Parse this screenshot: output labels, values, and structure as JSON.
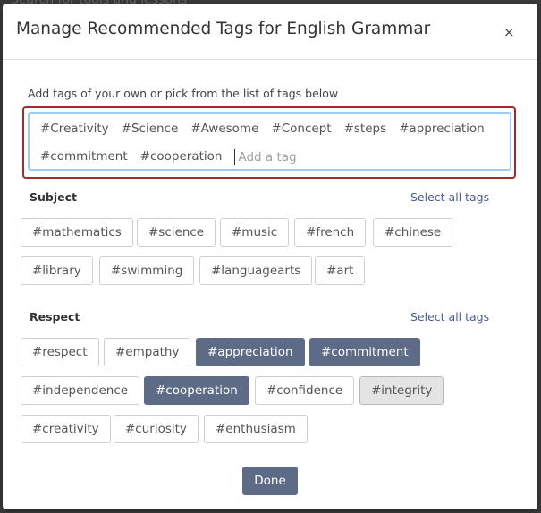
{
  "backdrop": {
    "text": "Search for tools and lessons"
  },
  "modal": {
    "title": "Manage Recommended Tags for English Grammar",
    "close_label": "×",
    "instruction": "Add tags of your own or pick from the list of tags below",
    "selected_tags": {
      "row1": [
        "#Creativity",
        "#Science",
        "#Awesome",
        "#Concept",
        "#steps",
        "#appreciation"
      ],
      "row2": [
        "#commitment",
        "#cooperation"
      ]
    },
    "input_placeholder": "Add a tag",
    "select_all_label": "Select all tags",
    "subject": {
      "title": "Subject",
      "tags": [
        "#mathematics",
        "#science",
        "#music",
        "#french",
        "#chinese",
        "#library",
        "#swimming",
        "#languagearts",
        "#art"
      ]
    },
    "respect": {
      "title": "Respect",
      "tags": [
        "#respect",
        "#empathy",
        "#appreciation",
        "#commitment",
        "#independence",
        "#cooperation",
        "#confidence",
        "#integrity",
        "#creativity",
        "#curiosity",
        "#enthusiasm"
      ],
      "selected": [
        "#appreciation",
        "#commitment",
        "#cooperation"
      ],
      "hovered": [
        "#integrity"
      ]
    },
    "done_label": "Done"
  },
  "colors": {
    "selected_chip": "#5d6b87",
    "field_highlight": "#a32a2a",
    "input_focus": "#9fcbef",
    "link": "#4a5c8a"
  }
}
